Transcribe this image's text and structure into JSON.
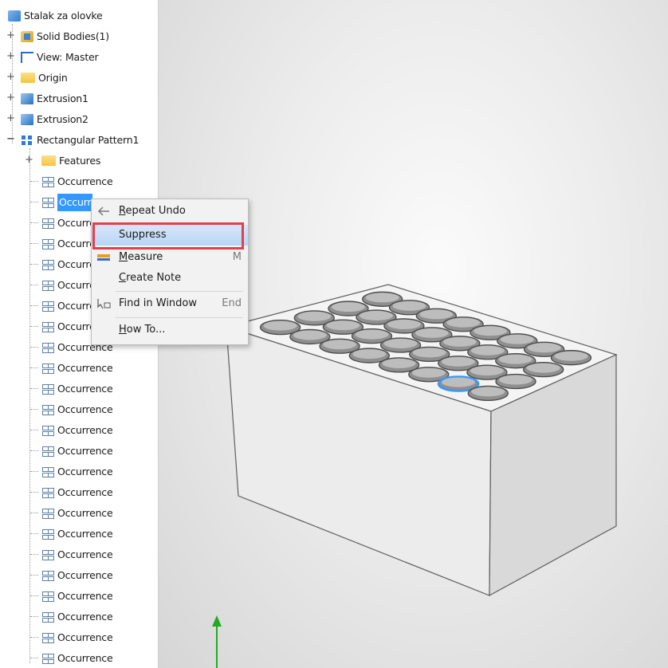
{
  "browser": {
    "root": "Stalak za olovke",
    "items": [
      {
        "label": "Solid Bodies(1)",
        "icon": "solid-bodies-icon"
      },
      {
        "label": "View: Master",
        "icon": "view-icon"
      },
      {
        "label": "Origin",
        "icon": "folder-icon"
      },
      {
        "label": "Extrusion1",
        "icon": "extrusion-icon"
      },
      {
        "label": "Extrusion2",
        "icon": "extrusion-icon"
      },
      {
        "label": "Rectangular Pattern1",
        "icon": "rectangular-pattern-icon"
      }
    ],
    "pattern_children": {
      "features_label": "Features",
      "occurrence_label": "Occurrence",
      "selected_label": "Occurr"
    }
  },
  "context_menu": {
    "items": [
      {
        "label": "Repeat Undo",
        "shortcut": "",
        "icon": "undo-arrow-icon"
      },
      {
        "label": "Suppress",
        "shortcut": "",
        "icon": ""
      },
      {
        "label": "Measure",
        "shortcut": "M",
        "icon": "measure-icon"
      },
      {
        "label": "Create Note",
        "shortcut": "",
        "icon": ""
      },
      {
        "label": "Find in Window",
        "shortcut": "End",
        "icon": "find-in-window-icon"
      },
      {
        "label": "How To...",
        "shortcut": "",
        "icon": ""
      }
    ],
    "highlighted_item": "Suppress",
    "highlight_color": "#e2404a"
  },
  "colors": {
    "selection": "#3399ff",
    "viewport_bg": "#e6e6e6",
    "model_face": "#f3f3f3",
    "triad_y": "#22aa22"
  }
}
